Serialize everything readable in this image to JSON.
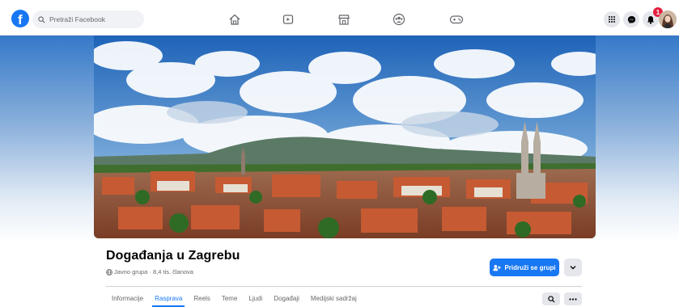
{
  "header": {
    "search": {
      "placeholder": "Pretraži Facebook"
    },
    "nav_icons": [
      "home-icon",
      "video-icon",
      "marketplace-icon",
      "groups-icon",
      "gaming-icon"
    ],
    "right_icons": [
      "menu-grid-icon",
      "messenger-icon",
      "notifications-icon"
    ],
    "notifications_count": "1"
  },
  "group": {
    "title": "Događanja u Zagrebu",
    "meta": "Javno grupa · 8,4 tis. članova",
    "join_label": "Pridruži se grupi"
  },
  "tabs": [
    {
      "label": "Informacije"
    },
    {
      "label": "Rasprava",
      "active": true
    },
    {
      "label": "Reels"
    },
    {
      "label": "Teme"
    },
    {
      "label": "Ljudi"
    },
    {
      "label": "Događaji"
    },
    {
      "label": "Medijski sadržaj"
    }
  ],
  "colors": {
    "accent": "#1877f2",
    "badge": "#e41e3f",
    "secondary_text": "#65676b"
  }
}
